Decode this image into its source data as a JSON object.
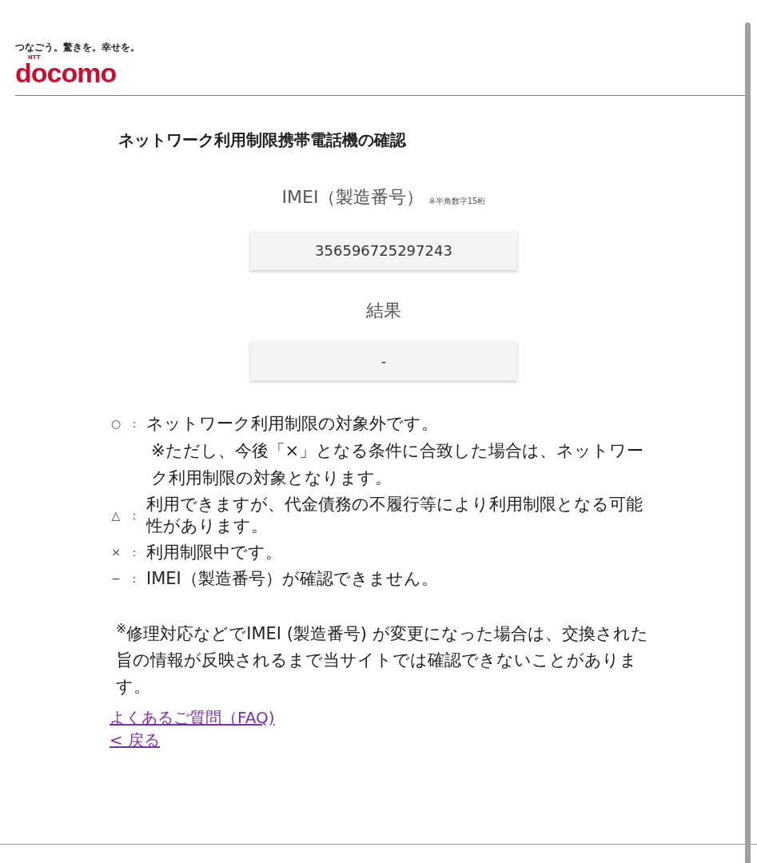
{
  "header": {
    "tagline": "つなごう。驚きを。幸せを。",
    "logo_small": "NTT",
    "logo": "docomo"
  },
  "title": "ネットワーク利用制限携帯電話機の確認",
  "imei": {
    "label": "IMEI（製造番号）",
    "hint": "※半角数字15桁",
    "value": "356596725297243"
  },
  "result": {
    "label": "結果",
    "value": "-"
  },
  "legend": [
    {
      "symbol": "○",
      "separator": "：",
      "text": "ネットワーク利用制限の対象外です。",
      "note": "※ただし、今後「×」となる条件に合致した場合は、ネットワーク利用制限の対象となります。"
    },
    {
      "symbol": "△",
      "separator": "：",
      "text": "利用できますが、代金債務の不履行等により利用制限となる可能性があります。"
    },
    {
      "symbol": "×",
      "separator": "：",
      "text": "利用制限中です。"
    },
    {
      "symbol": "−",
      "separator": "：",
      "text": "IMEI（製造番号）が確認できません。"
    }
  ],
  "notice": "$^{※}$修理対応などでIMEI (製造番号) が変更になった場合は、交換された旨の情報が反映されるまで当サイトでは確認できないことがあります。",
  "links": [
    "よくあるご質問（FAQ)",
    "< 戻る"
  ]
}
